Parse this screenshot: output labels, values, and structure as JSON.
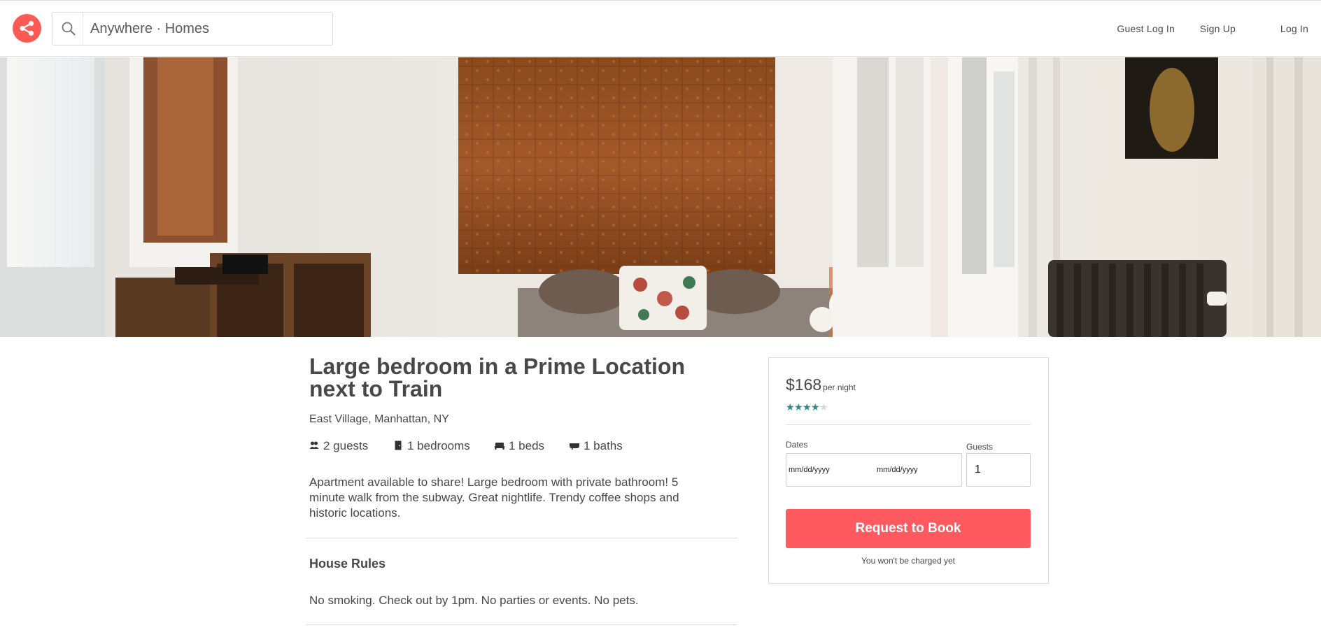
{
  "header": {
    "logo_icon": "share-icon",
    "search": {
      "placeholder": "Anywhere · Homes",
      "icon": "search-icon"
    },
    "nav": [
      "Guest Log In",
      "Sign Up",
      "Log In"
    ]
  },
  "hero": {
    "image": "bedroom-photo"
  },
  "listing": {
    "title": "Large bedroom in a Prime Location next to Train",
    "location": "East Village, Manhattan, NY",
    "amenities": [
      {
        "icon": "guests-icon",
        "label": "2 guests"
      },
      {
        "icon": "door-icon",
        "label": "1 bedrooms"
      },
      {
        "icon": "bed-icon",
        "label": "1 beds"
      },
      {
        "icon": "bath-icon",
        "label": "1 baths"
      }
    ],
    "description": "Apartment available to share! Large bedroom with private bathroom! 5 minute walk from the subway. Great nightlife. Trendy coffee shops and historic locations.",
    "house_rules": {
      "heading": "House Rules",
      "text": "No smoking. Check out by 1pm. No parties or events. No pets."
    }
  },
  "booking": {
    "price": "$168",
    "per_night": "per night",
    "rating": 4,
    "rating_max": 5,
    "dates_label": "Dates",
    "checkin_placeholder": "mm/dd/yyyy",
    "checkout_placeholder": "mm/dd/yyyy",
    "guests_label": "Guests",
    "guests_value": "1",
    "button": "Request to Book",
    "note": "You won't be charged yet"
  },
  "colors": {
    "brand": "#fb5b54",
    "button": "#ff5a5f",
    "star": "#2d8a8a",
    "text": "#484848"
  }
}
